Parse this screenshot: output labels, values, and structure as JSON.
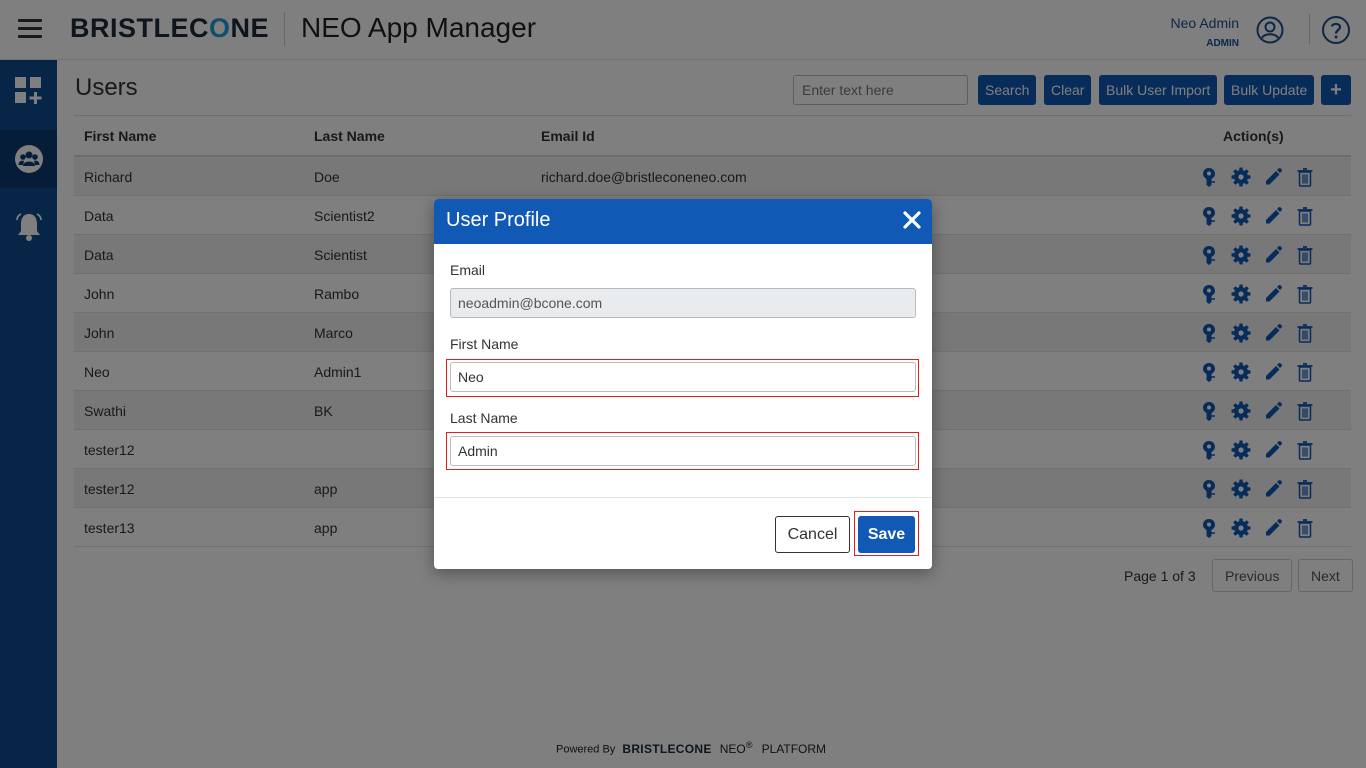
{
  "header": {
    "brand_left": "BRISTLEC",
    "brand_o": "O",
    "brand_right": "NE",
    "app_title": "NEO App Manager",
    "user_name": "Neo Admin",
    "user_role": "ADMIN",
    "user_icon": "user-circle-icon",
    "help_icon": "help-circle-icon"
  },
  "sidebar": {
    "items": [
      {
        "name": "apps",
        "icon": "dashboard-add-icon"
      },
      {
        "name": "users",
        "icon": "users-group-icon",
        "active": true
      },
      {
        "name": "notifications",
        "icon": "bell-icon"
      }
    ]
  },
  "page": {
    "title": "Users",
    "search_placeholder": "Enter text here",
    "search_btn": "Search",
    "clear_btn": "Clear",
    "bulk_import_btn": "Bulk User Import",
    "bulk_update_btn": "Bulk Update",
    "add_btn": "+"
  },
  "table": {
    "columns": [
      "First Name",
      "Last Name",
      "Email Id",
      "Action(s)"
    ],
    "rows": [
      {
        "first": "Richard",
        "last": "Doe",
        "email": "richard.doe@bristleconeneo.com"
      },
      {
        "first": "Data",
        "last": "Scientist2",
        "email": ""
      },
      {
        "first": "Data",
        "last": "Scientist",
        "email": ""
      },
      {
        "first": "John",
        "last": "Rambo",
        "email": ""
      },
      {
        "first": "John",
        "last": "Marco",
        "email": ""
      },
      {
        "first": "Neo",
        "last": "Admin1",
        "email": ""
      },
      {
        "first": "Swathi",
        "last": "BK",
        "email": ""
      },
      {
        "first": "tester12",
        "last": "",
        "email": ""
      },
      {
        "first": "tester12",
        "last": "app",
        "email": ""
      },
      {
        "first": "tester13",
        "last": "app",
        "email": ""
      }
    ],
    "action_icons": [
      "key-icon",
      "settings-icon",
      "edit-icon",
      "delete-icon"
    ]
  },
  "pagination": {
    "text": "Page 1 of 3",
    "previous": "Previous",
    "next": "Next"
  },
  "footer": {
    "powered_by": "Powered By",
    "brand": "BRISTLECONE",
    "neo": "NEO",
    "reg": "®",
    "platform": "PLATFORM"
  },
  "modal": {
    "title": "User Profile",
    "close_icon": "close-icon",
    "email_label": "Email",
    "email_value": "neoadmin@bcone.com",
    "first_label": "First Name",
    "first_value": "Neo",
    "last_label": "Last Name",
    "last_value": "Admin",
    "cancel": "Cancel",
    "save": "Save"
  },
  "colors": {
    "primary": "#1059b5",
    "sidebar": "#0e4b8f",
    "accent": "#1a9fd8",
    "highlight": "#e02020"
  }
}
